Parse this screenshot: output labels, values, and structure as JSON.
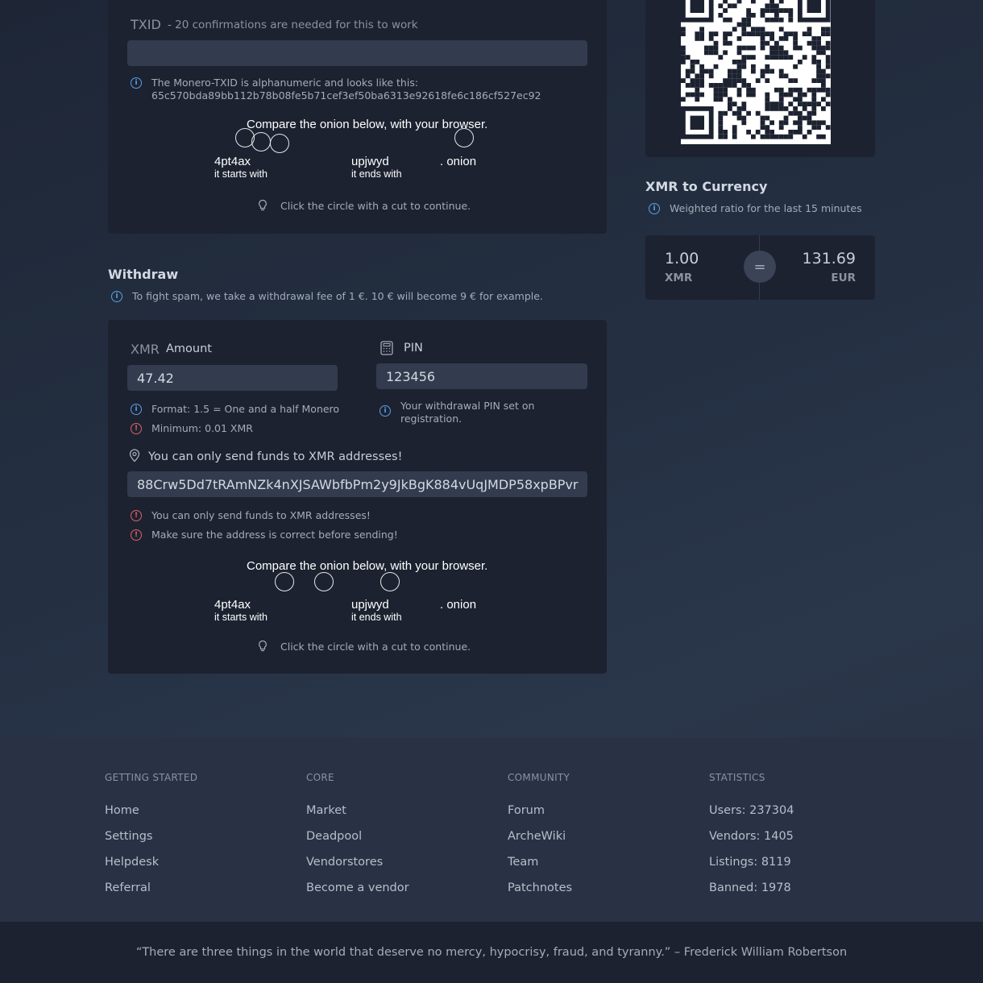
{
  "txid": {
    "label": "TXID",
    "sublabel": "- 20 confirmations are needed for this to work",
    "value": "",
    "note_line1": "The Monero-TXID is alphanumeric and looks like this:",
    "note_line2": "65c570bda89bb112b78b08fe5b71cef3ef50ba6313e92618fe6c186cf527ec92"
  },
  "captcha1": {
    "heading": "Compare the onion below, with your browser.",
    "start": "4pt4ax",
    "start_sub": "it starts with",
    "end": "upjwyd",
    "end_sub": "it ends with",
    "suffix": ". onion",
    "hint": "Click the circle with a cut to continue."
  },
  "withdraw": {
    "title": "Withdraw",
    "fee_note": "To fight spam, we take a withdrawal fee of 1 €. 10 € will become 9 € for example.",
    "amount_prefix": "XMR",
    "amount_label": "Amount",
    "amount_value": "47.42",
    "format_note": "Format: 1.5 = One and a half Monero",
    "minimum_note": "Minimum: 0.01 XMR",
    "pin_label": "PIN",
    "pin_value": "123456",
    "pin_note": "Your withdrawal PIN set on registration.",
    "address_label": "You can only send funds to XMR addresses!",
    "address_value": "88Crw5Dd7tRAmNZk4nXJSAWbfbPm2y9JkBgK884vUqJMDP58xpBPvr",
    "address_warn1": "You can only send funds to XMR addresses!",
    "address_warn2": "Make sure the address is correct before sending!"
  },
  "captcha2": {
    "heading": "Compare the onion below, with your browser.",
    "start": "4pt4ax",
    "start_sub": "it starts with",
    "end": "upjwyd",
    "end_sub": "it ends with",
    "suffix": ". onion",
    "hint": "Click the circle with a cut to continue."
  },
  "converter": {
    "title": "XMR to Currency",
    "note": "Weighted ratio for the last 15 minutes",
    "left_value": "1.00",
    "left_unit": "XMR",
    "equals": "=",
    "right_value": "131.69",
    "right_unit": "EUR"
  },
  "footer": {
    "columns": [
      {
        "heading": "GETTING STARTED",
        "links": [
          "Home",
          "Settings",
          "Helpdesk",
          "Referral"
        ]
      },
      {
        "heading": "CORE",
        "links": [
          "Market",
          "Deadpool",
          "Vendorstores",
          "Become a vendor"
        ]
      },
      {
        "heading": "COMMUNITY",
        "links": [
          "Forum",
          "ArcheWiki",
          "Team",
          "Patchnotes"
        ]
      },
      {
        "heading": "STATISTICS",
        "links": [
          "Users: 237304",
          "Vendors: 1405",
          "Listings: 8119",
          "Banned: 1978"
        ]
      }
    ],
    "quote": "“There are three things in the world that deserve no mercy, hypocrisy, fraud, and tyranny.” – Frederick William Robertson"
  },
  "colors": {
    "info": "#5aa0e6",
    "warning": "#e0606a",
    "card": "#1c2230",
    "input": "#323c4e"
  }
}
